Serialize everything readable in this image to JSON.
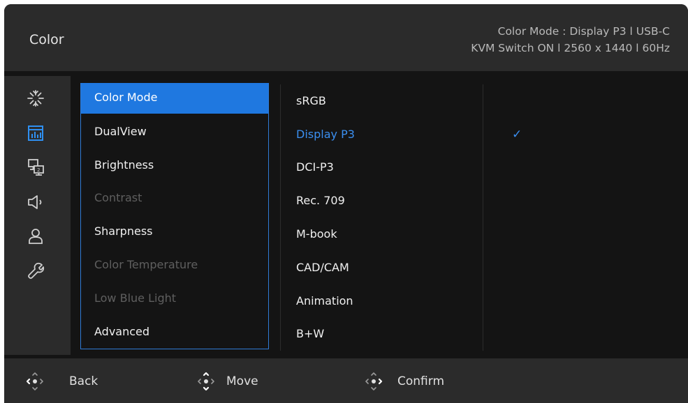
{
  "header": {
    "title": "Color",
    "info_line1": "Color Mode : Display P3   l   USB-C",
    "info_line2": "KVM Switch ON   l   2560 x 1440   l   60Hz"
  },
  "sidebar": {
    "icons": [
      {
        "name": "picture-sparkle-icon"
      },
      {
        "name": "color-chart-icon",
        "active": true
      },
      {
        "name": "multi-display-icon"
      },
      {
        "name": "speaker-icon"
      },
      {
        "name": "user-icon"
      },
      {
        "name": "wrench-icon"
      }
    ]
  },
  "menu": {
    "items": [
      {
        "label": "Color Mode",
        "state": "selected"
      },
      {
        "label": "DualView",
        "state": "enabled"
      },
      {
        "label": "Brightness",
        "state": "enabled"
      },
      {
        "label": "Contrast",
        "state": "disabled"
      },
      {
        "label": "Sharpness",
        "state": "enabled"
      },
      {
        "label": "Color Temperature",
        "state": "disabled"
      },
      {
        "label": "Low Blue Light",
        "state": "disabled"
      },
      {
        "label": "Advanced",
        "state": "enabled"
      }
    ]
  },
  "options": {
    "items": [
      {
        "label": "sRGB"
      },
      {
        "label": "Display P3",
        "active": true,
        "checked": true
      },
      {
        "label": "DCI-P3"
      },
      {
        "label": "Rec. 709"
      },
      {
        "label": "M-book"
      },
      {
        "label": "CAD/CAM"
      },
      {
        "label": "Animation"
      },
      {
        "label": "B+W"
      }
    ],
    "check_glyph": "✓"
  },
  "footer": {
    "back_label": "Back",
    "move_label": "Move",
    "confirm_label": "Confirm"
  },
  "colors": {
    "accent": "#1f78e0",
    "accent_text": "#3b8ff0",
    "panel": "#2b2b2b",
    "background": "#141414"
  }
}
